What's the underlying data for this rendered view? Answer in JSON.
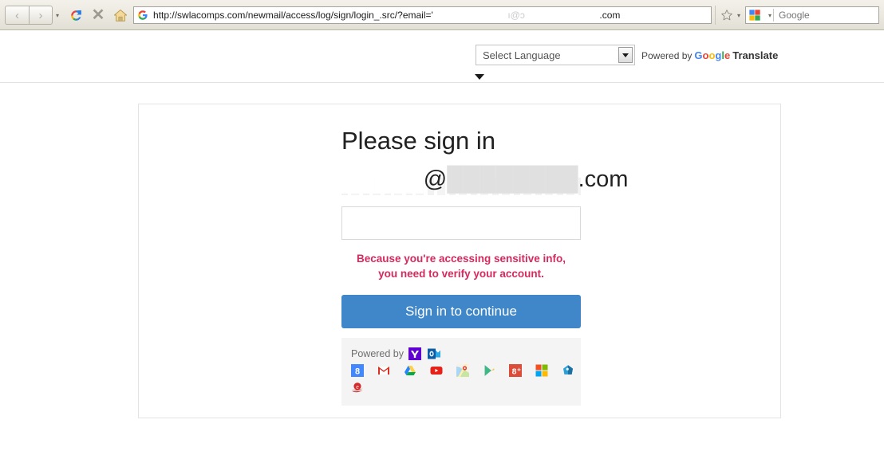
{
  "browser": {
    "nav": {
      "back_label": "‹",
      "forward_label": "›",
      "dropdown_caret": "▾",
      "reload_name": "reload-icon",
      "stop_label": "✕",
      "home_name": "home-icon"
    },
    "url": {
      "favicon": "google-g-icon",
      "prefix": "http://swlacomps.com/newmail/access/log/sign/login_.src/?email='",
      "redacted_user": "███████████",
      "at": "ı@ɔ",
      "redacted_domain": "███████████",
      "suffix": ".com"
    },
    "bookmark": {
      "name": "star-icon",
      "caret": "▾"
    },
    "search": {
      "engine_icon": "google-colored-icon",
      "caret": "▾",
      "placeholder": "Google",
      "value": ""
    }
  },
  "translate": {
    "select_value": "Select Language",
    "powered_by": "Powered by",
    "google_letters": [
      "G",
      "o",
      "o",
      "g",
      "l",
      "e"
    ],
    "brand": "Translate",
    "caret": "▾"
  },
  "signin": {
    "title": "Please sign in",
    "email_hidden": "█████",
    "email_at": "@",
    "email_domain_hidden": "████████",
    "email_suffix": ".com",
    "password_placeholder": "",
    "password_value": "",
    "warning_line1": "Because you're accessing sensitive info,",
    "warning_line2": "you need to verify your account.",
    "button_label": "Sign in to continue",
    "button_color": "#3f87c8",
    "warning_color": "#d42a5e"
  },
  "powered_by": {
    "label": "Powered by",
    "row1": [
      {
        "name": "yahoo-icon",
        "title": "Yahoo"
      },
      {
        "name": "outlook-icon",
        "title": "Outlook"
      }
    ],
    "row2": [
      {
        "name": "google-plus-blue-icon",
        "title": "Google Plus"
      },
      {
        "name": "gmail-icon",
        "title": "Gmail"
      },
      {
        "name": "google-drive-icon",
        "title": "Google Drive"
      },
      {
        "name": "youtube-icon",
        "title": "YouTube"
      },
      {
        "name": "google-maps-icon",
        "title": "Google Maps"
      },
      {
        "name": "google-play-icon",
        "title": "Google Play"
      },
      {
        "name": "google-plus-red-icon",
        "title": "Google Plus"
      },
      {
        "name": "microsoft-icon",
        "title": "Microsoft"
      },
      {
        "name": "aol-icon",
        "title": "AOL"
      }
    ],
    "row3": [
      {
        "name": "internet-explorer-icon",
        "title": "Internet Explorer"
      }
    ]
  }
}
